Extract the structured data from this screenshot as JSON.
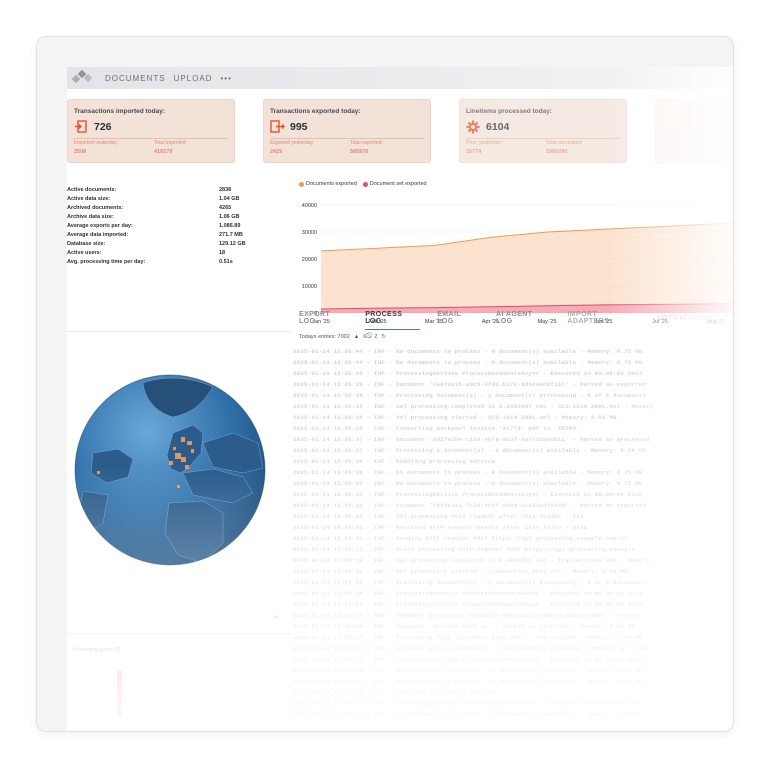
{
  "nav": {
    "items": [
      "DOCUMENTS",
      "UPLOAD",
      "•••"
    ]
  },
  "cards": [
    {
      "title": "Transactions imported today:",
      "value": "726",
      "icon": "import-icon",
      "sub": [
        {
          "label": "Imported yesterday:",
          "value": "2508"
        },
        {
          "label": "Total imported:",
          "value": "418279"
        }
      ]
    },
    {
      "title": "Transactions exported today:",
      "value": "995",
      "icon": "export-icon",
      "sub": [
        {
          "label": "Exported yesterday:",
          "value": "2429"
        },
        {
          "label": "Total exported:",
          "value": "585970"
        }
      ]
    },
    {
      "title": "Lineitems processed today:",
      "value": "6104",
      "icon": "gear-icon",
      "sub": [
        {
          "label": "Proc. yesterday:",
          "value": "25774"
        },
        {
          "label": "Total processed:",
          "value": "2960290"
        }
      ]
    }
  ],
  "stats": [
    {
      "label": "Active documents:",
      "value": "2838"
    },
    {
      "label": "Active data size:",
      "value": "1.04 GB"
    },
    {
      "label": "Archived documents:",
      "value": "4265"
    },
    {
      "label": "Archive data size:",
      "value": "1.06 GB"
    },
    {
      "label": "Average exports per day:",
      "value": "1,086.89"
    },
    {
      "label": "Average data imported:",
      "value": "271.7 MB"
    },
    {
      "label": "Database size:",
      "value": "129.12 GB"
    },
    {
      "label": "Active users:",
      "value": "18"
    },
    {
      "label": "Avg. processing time per day:",
      "value": "0.51s"
    }
  ],
  "chart_data": {
    "type": "area",
    "categories": [
      "Jan '25",
      "Feb '25",
      "Mar '25",
      "Apr '25",
      "May '25",
      "Jun '25",
      "Jul '25",
      "Aug '25",
      "Sep '25"
    ],
    "series": [
      {
        "name": "Documents exported",
        "color": "#f39a52",
        "values": [
          23000,
          24000,
          25000,
          28000,
          30000,
          31000,
          32000,
          33000,
          34000
        ]
      },
      {
        "name": "Document set exported",
        "color": "#e8457a",
        "values": [
          1500,
          1800,
          2000,
          2300,
          2700,
          3000,
          3200,
          3400,
          3600
        ]
      }
    ],
    "yticks": [
      "40000",
      "30000",
      "20000",
      "10000",
      "0"
    ],
    "ylim": [
      0,
      40000
    ]
  },
  "tabs": [
    "EXPORT LOG",
    "PROCESS LOG",
    "EMAIL LOG",
    "AI AGENT LOG",
    "IMPORT ADAPTERS",
    "NOTIFICATIONS"
  ],
  "active_tab": "PROCESS LOG",
  "entries": {
    "label": "Todays entries: 7002",
    "warnings": "6",
    "errors": "2"
  },
  "log_lines": [
    "2025-01-14 15:05:44 - INF - No documents to process - 0 document(s) available - Memory: 8.75 MB",
    "2025-01-14 15:05:44 - INF - No documents to process - 0 document(s) available - Memory: 8.75 MB",
    "2025-01-14 15:05:43 - INF - ProcessingService ProcessDocumentsAsync - Executed in 00:00:00.0013",
    "2025-01-14 15:05:39 - INF - Document '4a8f2e1b-a3c9-4fd1-b27e-9d1e4ac0f117' - Marked as exported",
    "2025-01-14 15:05:38 - INF - Processing document(s) - 1 document(s) processing - 6 of 6 documents",
    "2025-01-14 15:05:38 - INF - Xml processing completed in 0.0052497 sec - XCS-1019 XBRL.xml - Memory",
    "2025-01-14 15:05:38 - INF - Xml processing started - XCS-1019 XBRL.xml - Memory: 9.02 MB",
    "2025-01-14 15:05:38 - INF - Converting Workpool invoice 'XC778' pdf to 'XRINV'",
    "2025-01-14 15:05:37 - INF - Document '0d2fe1b4-c1e0-4b7a-9c3f-6a7c2d9e0b11' - Marked as processed",
    "2025-01-14 15:05:37 - INF - Processing 1 document(s) - 0 document(s) available - Memory: 8.80 MB",
    "2025-01-14 15:05:36 - INF - Enabling processing service",
    "2025-01-14 15:05:36 - INF - No documents to process - 0 document(s) available - Memory: 8.75 MB",
    "2025-01-14 15:05:35 - INF - No documents to process - 0 document(s) available - Memory: 8.75 MB",
    "2025-01-14 15:05:34 - INF - ProcessingService ProcessDocumentsAsync - Executed in 00:00:00.0010",
    "2025-01-14 15:05:33 - INF - Document 'b9f4e2a1-7c3d-4e5f-a8b6-1c2d3e4f5a6b' - Marked as exported",
    "2025-01-14 15:05:32 - INF - Xml processing XCS1 request after 1012 XCS1ML - 143",
    "2025-01-14 15:05:32 - INF - Received HTTP request header after 1034 Xmlms - Data",
    "2025-01-14 15:05:31 - INF - Sending HTTP request POST https://api.processing.example.com/v1",
    "2025-01-14 15:05:31 - INF - Start processing HTTP request POST https://api.processing.example",
    "2025-01-14 15:05:30 - INF - Xml processing completed in 0.0049811 sec - Transactions.xml - Memory",
    "2025-01-14 15:05:30 - INF - Xml processing started - transaction_0014.xml - Memory: 9.00 MB",
    "2025-01-14 15:05:29 - INF - Processing document(s) - 1 document(s) processing - 3 of 6 documents",
    "2025-01-14 15:05:28 - INF - ProcessingService ProcessDocumentsAsync - Executed in 00:00:00.0011",
    "2025-01-14 15:05:27 - INF - ProcessingService ProcessDocumentsAsync - Executed in 00:00:00.0012",
    "2025-01-14 15:05:27 - INF - Document processed '0f1e2d3c-4b5a-6978-8a9b-0c1d2e3f4a5b' - Memory",
    "2025-01-14 15:05:26 - INF - Document 'Archive 2025 Q1' - Marked as archived - Memory: 8.81 MB",
    "2025-01-14 15:05:25 - INF - Processing file 'Incoming_0114.pdf' - OCR started - Memory: 8.92 MB",
    "2025-01-14 15:05:24 - INF - Document export completed - 1 document(s) exported - Memory: 8.77 MB",
    "2025-01-14 15:05:23 - INF - ProcessingService ProcessDocumentsAsync - Executed in 00:00:00.0010",
    "2025-01-14 15:05:22 - INF - No documents to process - 0 document(s) available - Memory: 8.75 MB",
    "2025-01-14 15:05:21 - INF - No documents to process - 0 document(s) available - Memory: 8.75 MB",
    "2025-01-14 15:05:20 - INF - Enabling processing service",
    "2025-01-14 15:05:19 - INF - ProcessingService ProcessDocumentsAsync - Executed in 00:00:00.0013",
    "2025-01-14 15:05:18 - INF - No documents to process - 0 document(s) available - Memory: 8.75 MB"
  ],
  "bottom_label": "Processing queue (0)",
  "hh_label": "hh",
  "colors": {
    "accent": "#e8502a",
    "card_bg": "#f2e2d8",
    "globe": "#3b7fb8",
    "tab_underline": "#4f6fcf"
  }
}
